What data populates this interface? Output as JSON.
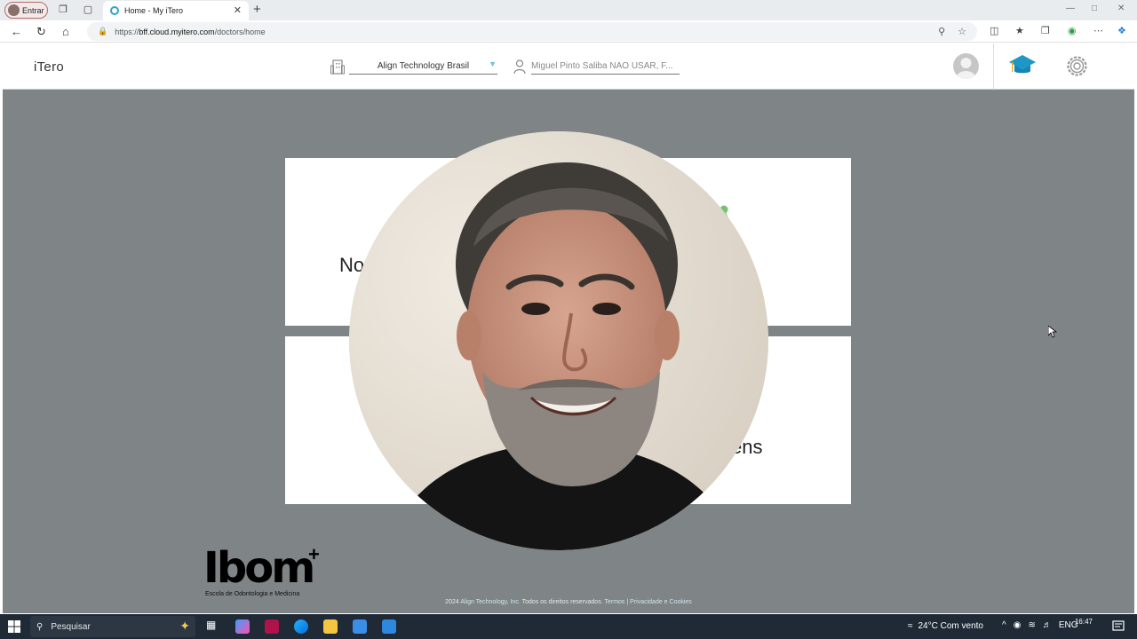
{
  "browser": {
    "profile_label": "Entrar",
    "tab_title": "Home - My iTero",
    "url_prefix": "https://",
    "url_host": "bff.cloud.myitero.com",
    "url_path": "/doctors/home"
  },
  "header": {
    "logo": "iTero",
    "practice": "Align Technology Brasil",
    "doctor_placeholder": "Miguel Pinto Saliba NAO USAR, F..."
  },
  "main": {
    "card1_text": "No",
    "card2_text": "ens",
    "brand_name": "Ibom",
    "brand_plus": "+",
    "brand_sub": "Escola de Odontologia e Medicina",
    "footer_prefix": "2024",
    "footer_company": "Align Technology, Inc.",
    "footer_rights": "Todos os direitos reservados.",
    "footer_terms": "Termos",
    "footer_sep": "|",
    "footer_privacy": "Privacidade e Cookies"
  },
  "taskbar": {
    "search_label": "Pesquisar",
    "weather": "24°C  Com vento",
    "lang": "ENG",
    "time": "16:47"
  },
  "colors": {
    "overlay": "#7f8486",
    "accent": "#2aa6c9",
    "taskbar": "#1f2a36"
  }
}
